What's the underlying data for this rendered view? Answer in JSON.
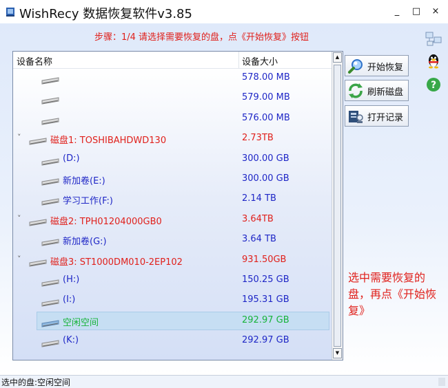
{
  "window": {
    "title": "WishRecy 数据恢复软件v3.85",
    "minimize_label": "_",
    "maximize_label": "□",
    "close_label": "×"
  },
  "instruction": "步骤：1/4 请选择需要恢复的盘，点《开始恢复》按钮",
  "device_list": {
    "columns": {
      "name": "设备名称",
      "size": "设备大小"
    },
    "rows": [
      {
        "name": "",
        "size": "578.00 MB",
        "level": "volume",
        "color": "blue"
      },
      {
        "name": "",
        "size": "579.00 MB",
        "level": "volume",
        "color": "blue"
      },
      {
        "name": "",
        "size": "576.00 MB",
        "level": "volume",
        "color": "blue"
      },
      {
        "name": "磁盘1: TOSHIBAHDWD130",
        "size": "2.73TB",
        "level": "disk",
        "color": "red"
      },
      {
        "name": "(D:)",
        "size": "300.00 GB",
        "level": "volume",
        "color": "blue"
      },
      {
        "name": "新加卷(E:)",
        "size": "300.00 GB",
        "level": "volume",
        "color": "blue"
      },
      {
        "name": "学习工作(F:)",
        "size": "2.14 TB",
        "level": "volume",
        "color": "blue"
      },
      {
        "name": "磁盘2: TPH01204000GB0",
        "size": "3.64TB",
        "level": "disk",
        "color": "red"
      },
      {
        "name": "新加卷(G:)",
        "size": "3.64 TB",
        "level": "volume",
        "color": "blue"
      },
      {
        "name": "磁盘3: ST1000DM010-2EP102",
        "size": "931.50GB",
        "level": "disk",
        "color": "red"
      },
      {
        "name": "(H:)",
        "size": "150.25 GB",
        "level": "volume",
        "color": "blue"
      },
      {
        "name": "(I:)",
        "size": "195.31 GB",
        "level": "volume",
        "color": "blue"
      },
      {
        "name": "空闲空间",
        "size": "292.97 GB",
        "level": "volume",
        "color": "green",
        "selected": true
      },
      {
        "name": "(K:)",
        "size": "292.97 GB",
        "level": "volume",
        "color": "blue"
      }
    ]
  },
  "actions": {
    "start_recovery": "开始恢复",
    "refresh_disks": "刷新磁盘",
    "open_record": "打开记录"
  },
  "hint": "选中需要恢复的盘，再点《开始恢复》",
  "status": "选中的盘:空闲空间",
  "icons": {
    "app": "app-icon",
    "side_toolbar": [
      "network-computers-icon",
      "qq-penguin-icon",
      "help-icon"
    ],
    "actions": [
      "magnifier-recover-icon",
      "refresh-icon",
      "record-icon"
    ]
  },
  "colors": {
    "disk_text": "#e0201b",
    "volume_text": "#1e26c6",
    "selected_text": "#17b33a",
    "selection_bg": "#c6def3"
  }
}
